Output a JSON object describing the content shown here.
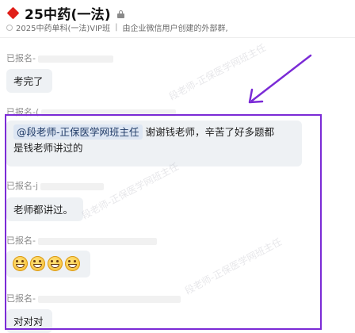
{
  "header": {
    "title": "25中药(一法)",
    "subtitle_group": "2025中药单科(一法)VIP班",
    "subtitle_sep": "|",
    "subtitle_desc": "由企业微信用户创建的外部群,"
  },
  "messages": [
    {
      "sender": "已报名-",
      "text": "考完了"
    },
    {
      "sender": "已报名-(",
      "mention": "@段老师-正保医学网班主任",
      "text_line1": "谢谢钱老师，辛苦了好多题都",
      "text_line2": "是钱老师讲过的"
    },
    {
      "sender": "已报名-j",
      "text": "老师都讲过。"
    },
    {
      "sender": "已报名-",
      "emoji": [
        "grin-icon",
        "grin-icon",
        "grin-icon",
        "grin-icon"
      ]
    },
    {
      "sender": "已报名-",
      "text": "对对对"
    }
  ],
  "watermark_text": "段老师-正保医学网班主任",
  "colors": {
    "highlight": "#7b2bd6",
    "bubble": "#eef1f4",
    "mention_bg": "#dde6f3"
  }
}
